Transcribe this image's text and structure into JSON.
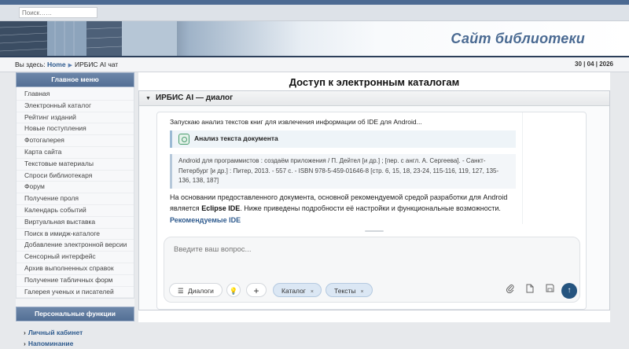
{
  "search": {
    "placeholder": "Поиск……"
  },
  "header": {
    "site_title": "Сайт библиотеки"
  },
  "breadcrumb": {
    "prefix": "Вы здесь:",
    "home": "Home",
    "current": "ИРБИС AI чат"
  },
  "date": "30 | 04 | 2026",
  "sidebar": {
    "main_menu_title": "Главное меню",
    "items": [
      "Главная",
      "Электронный каталог",
      "Рейтинг изданий",
      "Новые поступления",
      "Фотогалерея",
      "Карта сайта",
      "Текстовые материалы",
      "Спроси библиотекаря",
      "Форум",
      "Получение проля",
      "Календарь событий",
      "Виртуальная выставка",
      "Поиск в имидж-каталоге",
      "Добавление электронной версии",
      "Сенсорный интерфейс",
      "Архив выполненных справок",
      "Получение табличных форм",
      "Галерея ученых и писателей"
    ],
    "personal_title": "Персональные функции",
    "personal_items": [
      "Личный кабинет",
      "Напоминание"
    ]
  },
  "main": {
    "page_title": "Доступ к электронным каталогам",
    "panel_title": "ИРБИС AI — диалог"
  },
  "chat": {
    "status_line": "Запускаю анализ текстов книг для извлечения информации об IDE для Android...",
    "tool_label": "Анализ текста документа",
    "quote": "Android для программистов : создаём приложения / П. Дейтел [и др.] ; [пер. с англ. А. Сергеева]. - Санкт-Петербург [и др.] : Питер, 2013. - 557 с. - ISBN 978-5-459-01646-8 [стр. 6, 15, 18, 23-24, 115-116, 119, 127, 135-136, 138, 187]",
    "answer_pre": "На основании предоставленного документа, основной рекомендуемой средой разработки для Android является ",
    "answer_bold": "Eclipse IDE",
    "answer_post": ". Ниже приведены подробности её настройки и функциональные возможности.",
    "recommended_heading": "Рекомендуемые IDE"
  },
  "composer": {
    "placeholder": "Введите ваш вопрос...",
    "dialogs_label": "Диалоги",
    "tags": [
      "Каталог",
      "Тексты"
    ],
    "tag_close": "×"
  },
  "icons": {
    "dialogs": "menu-lines-icon",
    "idea": "lightbulb-icon",
    "add": "plus-icon",
    "attach": "paperclip-icon",
    "document": "document-icon",
    "save": "floppy-disk-icon",
    "send": "arrow-up-icon"
  },
  "colors": {
    "accent": "#4a6a92",
    "send": "#25547f",
    "link": "#2f5b8e"
  }
}
